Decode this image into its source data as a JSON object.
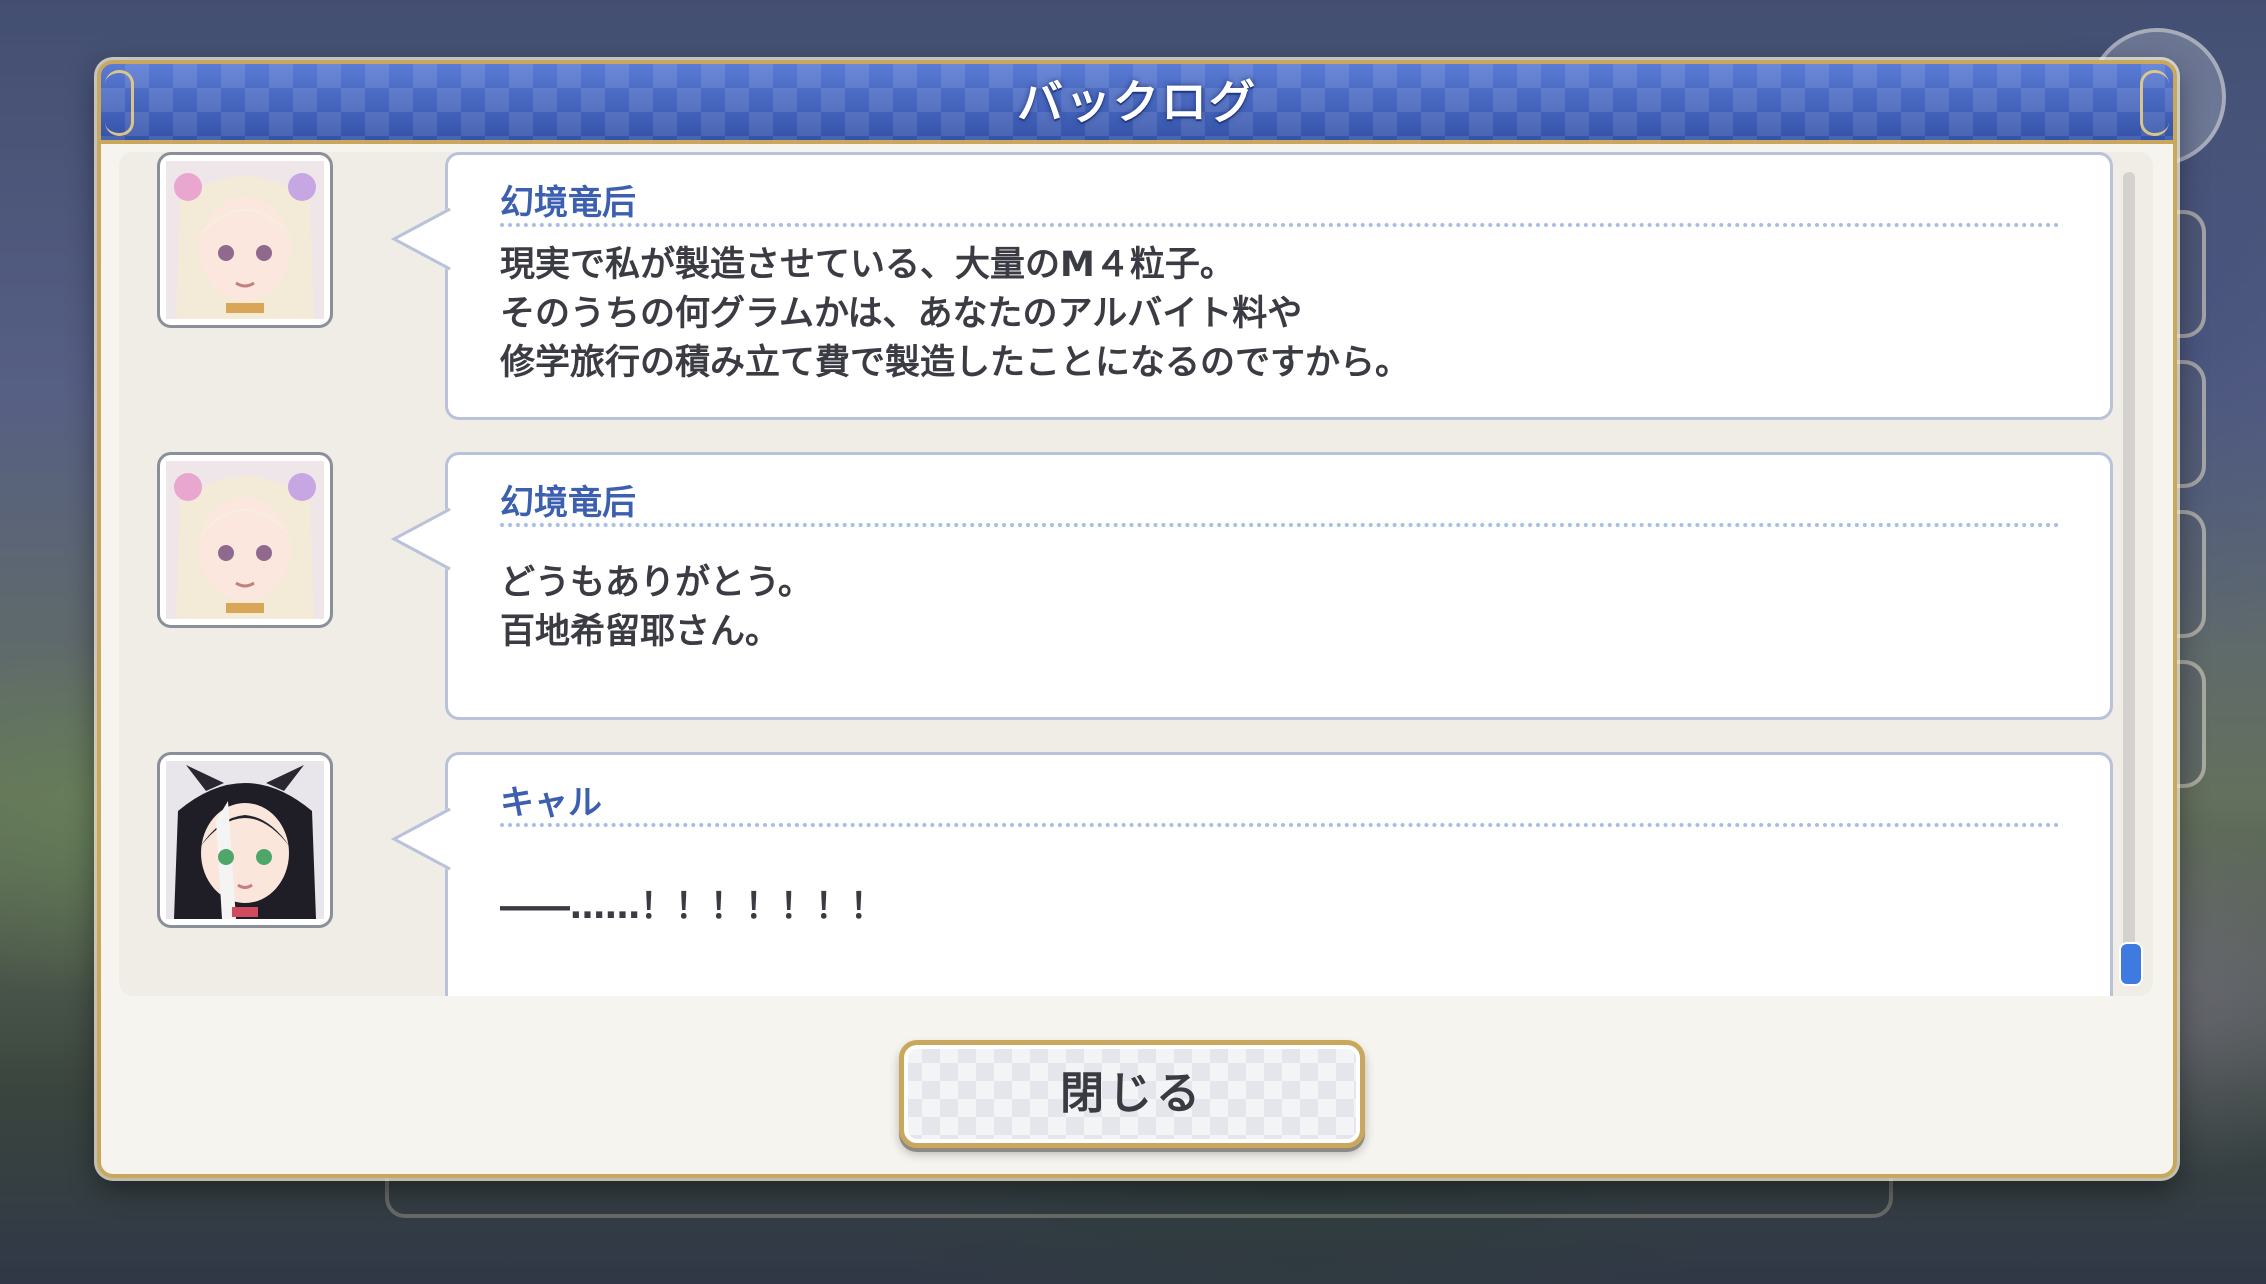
{
  "dialog": {
    "title": "バックログ",
    "close_label": "閉じる"
  },
  "entries": [
    {
      "speaker": "幻境竜后",
      "avatar": "character-portrait-pale-hair",
      "text": "現実で私が製造させている、大量のM４粒子。\nそのうちの何グラムかは、あなたのアルバイト料や\n修学旅行の積み立て費で製造したことになるのですから。"
    },
    {
      "speaker": "幻境竜后",
      "avatar": "character-portrait-pale-hair",
      "text": "どうもありがとう。\n百地希留耶さん。"
    },
    {
      "speaker": "キャル",
      "avatar": "character-portrait-black-hair-cat-ears",
      "text": "――……！！！！！！！"
    }
  ],
  "scrollbar": {
    "position": "bottom"
  },
  "colors": {
    "header_blue": "#3d5cb5",
    "gold_border": "#c9a85e",
    "speaker_name": "#3c5fb0",
    "scroll_thumb": "#3f7ae0"
  }
}
